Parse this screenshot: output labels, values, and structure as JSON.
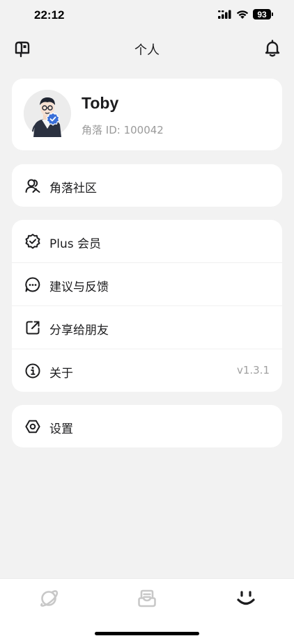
{
  "status_bar": {
    "time": "22:12",
    "battery": "93"
  },
  "nav": {
    "title": "个人",
    "left_icon": "mailbox-icon",
    "right_icon": "bell-icon"
  },
  "profile": {
    "name": "Toby",
    "id_text": "角落 ID: 100042"
  },
  "community": {
    "label": "角落社区",
    "icon": "people-icon"
  },
  "menu": [
    {
      "label": "Plus 会员",
      "icon": "badge-check-icon",
      "value": ""
    },
    {
      "label": "建议与反馈",
      "icon": "chat-dots-icon",
      "value": ""
    },
    {
      "label": "分享给朋友",
      "icon": "share-icon",
      "value": ""
    },
    {
      "label": "关于",
      "icon": "info-icon",
      "value": "v1.3.1"
    }
  ],
  "settings": {
    "label": "设置",
    "icon": "gear-icon"
  },
  "tab_bar": {
    "tabs": [
      {
        "name": "discover",
        "icon": "planet-icon",
        "active": false
      },
      {
        "name": "inbox",
        "icon": "inbox-icon",
        "active": false
      },
      {
        "name": "me",
        "icon": "smile-icon",
        "active": true
      }
    ]
  },
  "colors": {
    "background": "#f2f2f2",
    "card": "#ffffff",
    "text": "#1c1c1e",
    "muted": "#9a9a9a",
    "accent": "#3a6fd8",
    "inactive_tab": "#c8c8c8"
  }
}
